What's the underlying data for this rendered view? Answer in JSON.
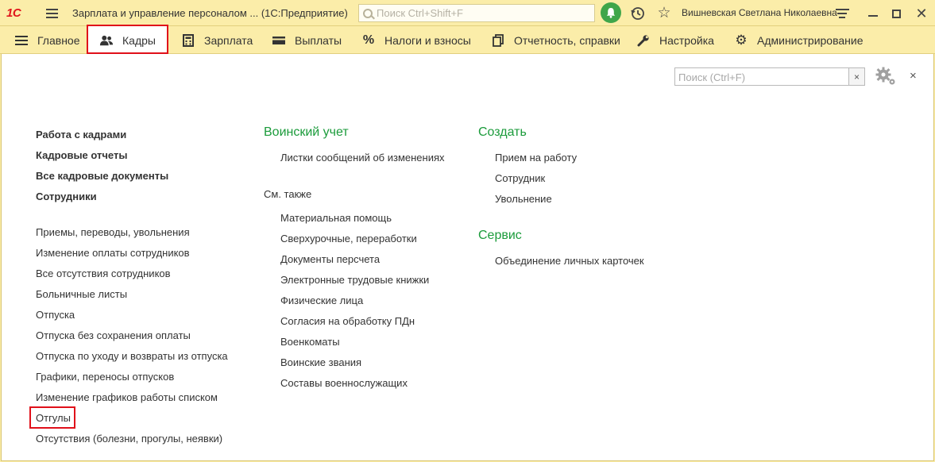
{
  "titlebar": {
    "logo": "1С",
    "app_title": "Зарплата и управление персоналом ...  (1С:Предприятие)",
    "search_placeholder": "Поиск Ctrl+Shift+F",
    "user_name": "Вишневская Светлана Николаевна",
    "icons": [
      "menu-icon",
      "bell-icon",
      "history-icon",
      "star-icon",
      "settings-icon",
      "minimize-icon",
      "maximize-icon",
      "close-icon"
    ]
  },
  "sections": [
    {
      "label": "Главное",
      "icon": "menu-icon"
    },
    {
      "label": "Кадры",
      "icon": "people-icon",
      "active": true
    },
    {
      "label": "Зарплата",
      "icon": "calculator-icon"
    },
    {
      "label": "Выплаты",
      "icon": "wallet-icon"
    },
    {
      "label": "Налоги и взносы",
      "icon": "percent-icon"
    },
    {
      "label": "Отчетность, справки",
      "icon": "documents-icon"
    },
    {
      "label": "Настройка",
      "icon": "wrench-icon"
    },
    {
      "label": "Администрирование",
      "icon": "gear-icon"
    }
  ],
  "panel": {
    "search_placeholder": "Поиск (Ctrl+F)",
    "clear": "×",
    "close": "×"
  },
  "col1": {
    "bold_items": [
      "Работа с кадрами",
      "Кадровые отчеты",
      "Все кадровые документы",
      "Сотрудники"
    ],
    "items": [
      "Приемы, переводы, увольнения",
      "Изменение оплаты сотрудников",
      "Все отсутствия сотрудников",
      "Больничные листы",
      "Отпуска",
      "Отпуска без сохранения оплаты",
      "Отпуска по уходу и возвраты из отпуска",
      "Графики, переносы отпусков",
      "Изменение графиков работы списком",
      "Отгулы",
      "Отсутствия (болезни, прогулы, неявки)"
    ]
  },
  "col2": {
    "group_title": "Воинский учет",
    "group_items": [
      "Листки сообщений об изменениях"
    ],
    "see_also": "См. также",
    "see_also_items": [
      "Материальная помощь",
      "Сверхурочные, переработки",
      "Документы персчета",
      "Электронные трудовые книжки",
      "Физические лица",
      "Согласия на обработку ПДн",
      "Военкоматы",
      "Воинские звания",
      "Составы военнослужащих"
    ]
  },
  "col3": {
    "create_title": "Создать",
    "create_items": [
      "Прием на работу",
      "Сотрудник",
      "Увольнение"
    ],
    "service_title": "Сервис",
    "service_items": [
      "Объединение личных карточек"
    ]
  },
  "colors": {
    "window_bg": "#fbeda9",
    "group_title": "#1b9b3b",
    "highlight": "#e0101a",
    "bell": "#3fa64a"
  }
}
